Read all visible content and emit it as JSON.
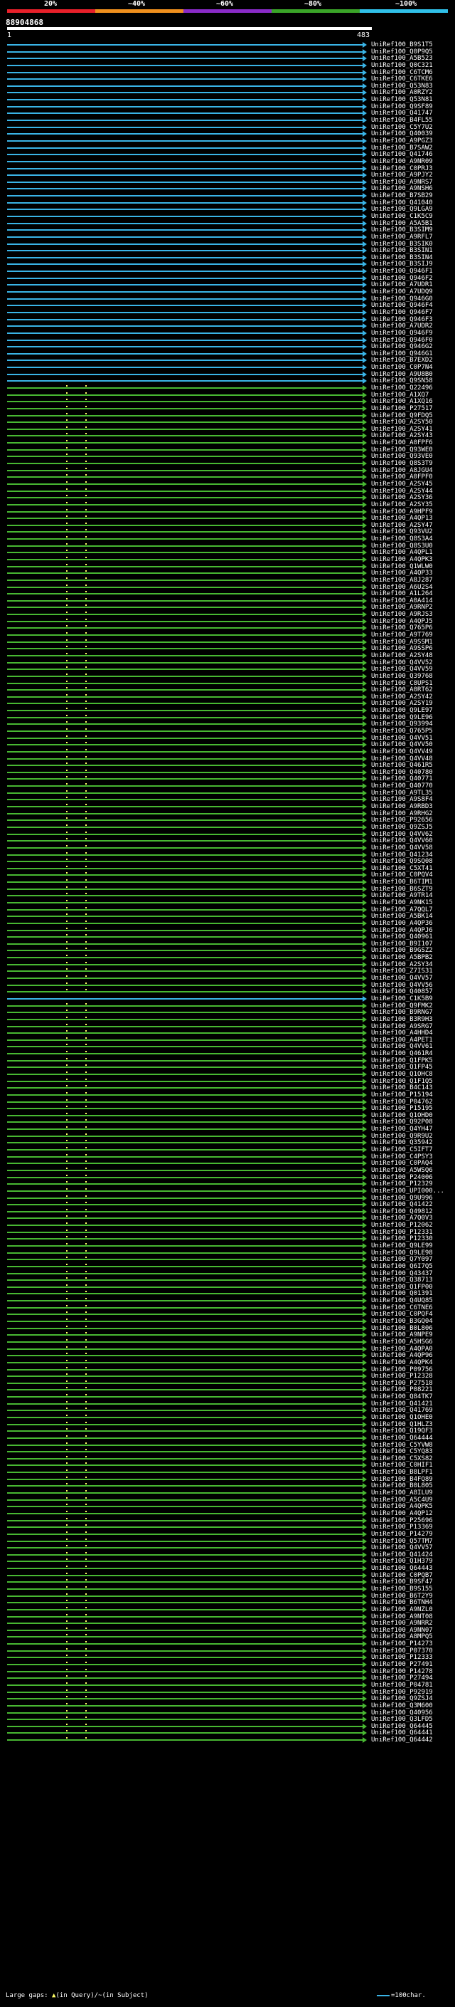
{
  "scale_labels": [
    "20%",
    "~40%",
    "~60%",
    "~80%",
    "~100%"
  ],
  "scale_colors": [
    "#e8202a",
    "#f0901e",
    "#8a2bc8",
    "#3aa428",
    "#30c0e8"
  ],
  "query_id": "88904868",
  "ruler": {
    "start": "1",
    "end": "483"
  },
  "colors": {
    "cyan": "#3ab4e6",
    "green": "#48b832",
    "gap": "#ffff66"
  },
  "hits": [
    {
      "id": "UniRef100_B9S1T5",
      "c": "cyan"
    },
    {
      "id": "UniRef100_Q0P9Q5",
      "c": "cyan"
    },
    {
      "id": "UniRef100_A5B523",
      "c": "cyan"
    },
    {
      "id": "UniRef100_Q0C321",
      "c": "cyan"
    },
    {
      "id": "UniRef100_C6TCM6",
      "c": "cyan"
    },
    {
      "id": "UniRef100_C6TKE6",
      "c": "cyan"
    },
    {
      "id": "UniRef100_Q53N83",
      "c": "cyan"
    },
    {
      "id": "UniRef100_A0RZY2",
      "c": "cyan"
    },
    {
      "id": "UniRef100_Q53N81",
      "c": "cyan"
    },
    {
      "id": "UniRef100_Q9SF89",
      "c": "cyan"
    },
    {
      "id": "UniRef100_Q41747",
      "c": "cyan"
    },
    {
      "id": "UniRef100_B4FL55",
      "c": "cyan"
    },
    {
      "id": "UniRef100_C5Y7U2",
      "c": "cyan"
    },
    {
      "id": "UniRef100_Q40039",
      "c": "cyan"
    },
    {
      "id": "UniRef100_A9PGZ3",
      "c": "cyan"
    },
    {
      "id": "UniRef100_B7SAW2",
      "c": "cyan"
    },
    {
      "id": "UniRef100_Q41746",
      "c": "cyan"
    },
    {
      "id": "UniRef100_A9NR09",
      "c": "cyan"
    },
    {
      "id": "UniRef100_C0PRJ3",
      "c": "cyan"
    },
    {
      "id": "UniRef100_A9PJY2",
      "c": "cyan"
    },
    {
      "id": "UniRef100_A9NRS7",
      "c": "cyan"
    },
    {
      "id": "UniRef100_A9NSH6",
      "c": "cyan"
    },
    {
      "id": "UniRef100_B7SB29",
      "c": "cyan"
    },
    {
      "id": "UniRef100_Q41040",
      "c": "cyan"
    },
    {
      "id": "UniRef100_Q9LGA9",
      "c": "cyan"
    },
    {
      "id": "UniRef100_C1K5C9",
      "c": "cyan"
    },
    {
      "id": "UniRef100_A5A5B1",
      "c": "cyan"
    },
    {
      "id": "UniRef100_B3SIM9",
      "c": "cyan"
    },
    {
      "id": "UniRef100_A9RFL7",
      "c": "cyan"
    },
    {
      "id": "UniRef100_B3SIK0",
      "c": "cyan"
    },
    {
      "id": "UniRef100_B3SIN1",
      "c": "cyan"
    },
    {
      "id": "UniRef100_B3SIN4",
      "c": "cyan"
    },
    {
      "id": "UniRef100_B3SIJ9",
      "c": "cyan"
    },
    {
      "id": "UniRef100_Q946F1",
      "c": "cyan"
    },
    {
      "id": "UniRef100_Q946F2",
      "c": "cyan"
    },
    {
      "id": "UniRef100_A7UDR1",
      "c": "cyan"
    },
    {
      "id": "UniRef100_A7UDQ9",
      "c": "cyan"
    },
    {
      "id": "UniRef100_Q946G0",
      "c": "cyan"
    },
    {
      "id": "UniRef100_Q946F4",
      "c": "cyan"
    },
    {
      "id": "UniRef100_Q946F7",
      "c": "cyan"
    },
    {
      "id": "UniRef100_Q946F3",
      "c": "cyan"
    },
    {
      "id": "UniRef100_A7UDR2",
      "c": "cyan"
    },
    {
      "id": "UniRef100_Q946F9",
      "c": "cyan"
    },
    {
      "id": "UniRef100_Q946F0",
      "c": "cyan"
    },
    {
      "id": "UniRef100_Q946G2",
      "c": "cyan"
    },
    {
      "id": "UniRef100_Q946G1",
      "c": "cyan"
    },
    {
      "id": "UniRef100_B7EXD2",
      "c": "cyan"
    },
    {
      "id": "UniRef100_C0P7N4",
      "c": "cyan"
    },
    {
      "id": "UniRef100_A9U8B0",
      "c": "cyan"
    },
    {
      "id": "UniRef100_Q9SN58",
      "c": "cyan"
    },
    {
      "id": "UniRef100_Q22496",
      "c": "green"
    },
    {
      "id": "UniRef100_A1XQ7",
      "c": "green"
    },
    {
      "id": "UniRef100_A1XQ16",
      "c": "green"
    },
    {
      "id": "UniRef100_P27517",
      "c": "green"
    },
    {
      "id": "UniRef100_Q9FDQ5",
      "c": "green"
    },
    {
      "id": "UniRef100_A2SY50",
      "c": "green"
    },
    {
      "id": "UniRef100_A2SY41",
      "c": "green"
    },
    {
      "id": "UniRef100_A2SY43",
      "c": "green"
    },
    {
      "id": "UniRef100_A0FPF6",
      "c": "green"
    },
    {
      "id": "UniRef100_Q93WE0",
      "c": "green"
    },
    {
      "id": "UniRef100_Q93VE0",
      "c": "green"
    },
    {
      "id": "UniRef100_Q8S3T9",
      "c": "green"
    },
    {
      "id": "UniRef100_A8JGU4",
      "c": "green"
    },
    {
      "id": "UniRef100_A0FPF0",
      "c": "green"
    },
    {
      "id": "UniRef100_A2SY45",
      "c": "green"
    },
    {
      "id": "UniRef100_A2SY44",
      "c": "green"
    },
    {
      "id": "UniRef100_A2SY36",
      "c": "green"
    },
    {
      "id": "UniRef100_A2SY35",
      "c": "green"
    },
    {
      "id": "UniRef100_A9HPF9",
      "c": "green"
    },
    {
      "id": "UniRef100_A4QP13",
      "c": "green"
    },
    {
      "id": "UniRef100_A2SY47",
      "c": "green"
    },
    {
      "id": "UniRef100_Q93VU2",
      "c": "green"
    },
    {
      "id": "UniRef100_Q8S3A4",
      "c": "green"
    },
    {
      "id": "UniRef100_Q8S3U0",
      "c": "green"
    },
    {
      "id": "UniRef100_A4QPL1",
      "c": "green"
    },
    {
      "id": "UniRef100_A4QPK3",
      "c": "green"
    },
    {
      "id": "UniRef100_Q1WLW0",
      "c": "green"
    },
    {
      "id": "UniRef100_A4QP33",
      "c": "green"
    },
    {
      "id": "UniRef100_A8J287",
      "c": "green"
    },
    {
      "id": "UniRef100_A6U2S4",
      "c": "green"
    },
    {
      "id": "UniRef100_A1L264",
      "c": "green"
    },
    {
      "id": "UniRef100_A0A414",
      "c": "green"
    },
    {
      "id": "UniRef100_A9RNP2",
      "c": "green"
    },
    {
      "id": "UniRef100_A9RJS3",
      "c": "green"
    },
    {
      "id": "UniRef100_A4QPJ5",
      "c": "green"
    },
    {
      "id": "UniRef100_Q765P6",
      "c": "green"
    },
    {
      "id": "UniRef100_A9T769",
      "c": "green"
    },
    {
      "id": "UniRef100_A9SSM1",
      "c": "green"
    },
    {
      "id": "UniRef100_A9SSP6",
      "c": "green"
    },
    {
      "id": "UniRef100_A2SY48",
      "c": "green"
    },
    {
      "id": "UniRef100_Q4VV52",
      "c": "green"
    },
    {
      "id": "UniRef100_Q4VV59",
      "c": "green"
    },
    {
      "id": "UniRef100_Q39768",
      "c": "green"
    },
    {
      "id": "UniRef100_C8UPS1",
      "c": "green"
    },
    {
      "id": "UniRef100_A0RT62",
      "c": "green"
    },
    {
      "id": "UniRef100_A2SY42",
      "c": "green"
    },
    {
      "id": "UniRef100_A2SY19",
      "c": "green"
    },
    {
      "id": "UniRef100_Q9LE97",
      "c": "green"
    },
    {
      "id": "UniRef100_Q9LE96",
      "c": "green"
    },
    {
      "id": "UniRef100_Q93994",
      "c": "green"
    },
    {
      "id": "UniRef100_Q765P5",
      "c": "green"
    },
    {
      "id": "UniRef100_Q4VV51",
      "c": "green"
    },
    {
      "id": "UniRef100_Q4VV50",
      "c": "green"
    },
    {
      "id": "UniRef100_Q4VV49",
      "c": "green"
    },
    {
      "id": "UniRef100_Q4VV48",
      "c": "green"
    },
    {
      "id": "UniRef100_Q461R5",
      "c": "green"
    },
    {
      "id": "UniRef100_Q40780",
      "c": "green"
    },
    {
      "id": "UniRef100_Q40771",
      "c": "green"
    },
    {
      "id": "UniRef100_Q40770",
      "c": "green"
    },
    {
      "id": "UniRef100_A9TL35",
      "c": "green"
    },
    {
      "id": "UniRef100_A9S8F4",
      "c": "green"
    },
    {
      "id": "UniRef100_A9RBD3",
      "c": "green"
    },
    {
      "id": "UniRef100_A9RHG2",
      "c": "green"
    },
    {
      "id": "UniRef100_P92656",
      "c": "green"
    },
    {
      "id": "UniRef100_Q9ZSJ5",
      "c": "green"
    },
    {
      "id": "UniRef100_Q4VV62",
      "c": "green"
    },
    {
      "id": "UniRef100_Q4VV60",
      "c": "green"
    },
    {
      "id": "UniRef100_Q4VV58",
      "c": "green"
    },
    {
      "id": "UniRef100_Q41234",
      "c": "green"
    },
    {
      "id": "UniRef100_Q9SQ08",
      "c": "green"
    },
    {
      "id": "UniRef100_C5XT41",
      "c": "green"
    },
    {
      "id": "UniRef100_C0PQV4",
      "c": "green"
    },
    {
      "id": "UniRef100_B6TIM1",
      "c": "green"
    },
    {
      "id": "UniRef100_B6SZT9",
      "c": "green"
    },
    {
      "id": "UniRef100_A9TR14",
      "c": "green"
    },
    {
      "id": "UniRef100_A9NK15",
      "c": "green"
    },
    {
      "id": "UniRef100_A7QQL7",
      "c": "green"
    },
    {
      "id": "UniRef100_A5BK14",
      "c": "green"
    },
    {
      "id": "UniRef100_A4QP36",
      "c": "green"
    },
    {
      "id": "UniRef100_A4QPJ6",
      "c": "green"
    },
    {
      "id": "UniRef100_Q40961",
      "c": "green"
    },
    {
      "id": "UniRef100_B9I107",
      "c": "green"
    },
    {
      "id": "UniRef100_B9GSZ2",
      "c": "green"
    },
    {
      "id": "UniRef100_A5BPB2",
      "c": "green"
    },
    {
      "id": "UniRef100_A2SY34",
      "c": "green"
    },
    {
      "id": "UniRef100_Z7IS31",
      "c": "green"
    },
    {
      "id": "UniRef100_Q4VV57",
      "c": "green"
    },
    {
      "id": "UniRef100_Q4VV56",
      "c": "green"
    },
    {
      "id": "UniRef100_Q40857",
      "c": "green"
    },
    {
      "id": "UniRef100_C1K5B9",
      "c": "cyan"
    },
    {
      "id": "UniRef100_Q9FMK2",
      "c": "green"
    },
    {
      "id": "UniRef100_B9RNG7",
      "c": "green"
    },
    {
      "id": "UniRef100_B3R9H3",
      "c": "green"
    },
    {
      "id": "UniRef100_A9SRG7",
      "c": "green"
    },
    {
      "id": "UniRef100_A4HHD4",
      "c": "green"
    },
    {
      "id": "UniRef100_A4PET1",
      "c": "green"
    },
    {
      "id": "UniRef100_Q4VV61",
      "c": "green"
    },
    {
      "id": "UniRef100_Q461R4",
      "c": "green"
    },
    {
      "id": "UniRef100_Q1FPK5",
      "c": "green"
    },
    {
      "id": "UniRef100_Q1FP45",
      "c": "green"
    },
    {
      "id": "UniRef100_Q1OHC8",
      "c": "green"
    },
    {
      "id": "UniRef100_Q1F1Q5",
      "c": "green"
    },
    {
      "id": "UniRef100_B4C143",
      "c": "green"
    },
    {
      "id": "UniRef100_P15194",
      "c": "green"
    },
    {
      "id": "UniRef100_P04762",
      "c": "green"
    },
    {
      "id": "UniRef100_P15195",
      "c": "green"
    },
    {
      "id": "UniRef100_Q1OHD0",
      "c": "green"
    },
    {
      "id": "UniRef100_Q92P08",
      "c": "green"
    },
    {
      "id": "UniRef100_Q4YH47",
      "c": "green"
    },
    {
      "id": "UniRef100_Q9R9U2",
      "c": "green"
    },
    {
      "id": "UniRef100_Q35942",
      "c": "green"
    },
    {
      "id": "UniRef100_C5IFT7",
      "c": "green"
    },
    {
      "id": "UniRef100_C4PSY3",
      "c": "green"
    },
    {
      "id": "UniRef100_C0PAQ4",
      "c": "green"
    },
    {
      "id": "UniRef100_A5WSQ6",
      "c": "green"
    },
    {
      "id": "UniRef100_P24006",
      "c": "green"
    },
    {
      "id": "UniRef100_P12329",
      "c": "green"
    },
    {
      "id": "UniRef100_UPI000...",
      "c": "green"
    },
    {
      "id": "UniRef100_Q9U996",
      "c": "green"
    },
    {
      "id": "UniRef100_Q41422",
      "c": "green"
    },
    {
      "id": "UniRef100_Q49812",
      "c": "green"
    },
    {
      "id": "UniRef100_A7Q0V3",
      "c": "green"
    },
    {
      "id": "UniRef100_P12062",
      "c": "green"
    },
    {
      "id": "UniRef100_P12331",
      "c": "green"
    },
    {
      "id": "UniRef100_P12330",
      "c": "green"
    },
    {
      "id": "UniRef100_Q9LE99",
      "c": "green"
    },
    {
      "id": "UniRef100_Q9LE98",
      "c": "green"
    },
    {
      "id": "UniRef100_Q7Y097",
      "c": "green"
    },
    {
      "id": "UniRef100_Q6I7Q5",
      "c": "green"
    },
    {
      "id": "UniRef100_Q43437",
      "c": "green"
    },
    {
      "id": "UniRef100_Q38713",
      "c": "green"
    },
    {
      "id": "UniRef100_Q1FP00",
      "c": "green"
    },
    {
      "id": "UniRef100_Q01391",
      "c": "green"
    },
    {
      "id": "UniRef100_Q4UQ85",
      "c": "green"
    },
    {
      "id": "UniRef100_C6TNE6",
      "c": "green"
    },
    {
      "id": "UniRef100_C0PQF4",
      "c": "green"
    },
    {
      "id": "UniRef100_B3GQ04",
      "c": "green"
    },
    {
      "id": "UniRef100_B0L806",
      "c": "green"
    },
    {
      "id": "UniRef100_A9NPE9",
      "c": "green"
    },
    {
      "id": "UniRef100_A5HSG6",
      "c": "green"
    },
    {
      "id": "UniRef100_A4QPA0",
      "c": "green"
    },
    {
      "id": "UniRef100_A4QP96",
      "c": "green"
    },
    {
      "id": "UniRef100_A4QPK4",
      "c": "green"
    },
    {
      "id": "UniRef100_P09756",
      "c": "green"
    },
    {
      "id": "UniRef100_P12328",
      "c": "green"
    },
    {
      "id": "UniRef100_P27518",
      "c": "green"
    },
    {
      "id": "UniRef100_P08221",
      "c": "green"
    },
    {
      "id": "UniRef100_Q84TK7",
      "c": "green"
    },
    {
      "id": "UniRef100_Q41421",
      "c": "green"
    },
    {
      "id": "UniRef100_Q41769",
      "c": "green"
    },
    {
      "id": "UniRef100_Q1OHE0",
      "c": "green"
    },
    {
      "id": "UniRef100_Q1HLZ3",
      "c": "green"
    },
    {
      "id": "UniRef100_Q19QF3",
      "c": "green"
    },
    {
      "id": "UniRef100_Q64444",
      "c": "green"
    },
    {
      "id": "UniRef100_C5YVW8",
      "c": "green"
    },
    {
      "id": "UniRef100_C5YQ83",
      "c": "green"
    },
    {
      "id": "UniRef100_C5XS82",
      "c": "green"
    },
    {
      "id": "UniRef100_C0HIF1",
      "c": "green"
    },
    {
      "id": "UniRef100_B8LPF1",
      "c": "green"
    },
    {
      "id": "UniRef100_B4FQ89",
      "c": "green"
    },
    {
      "id": "UniRef100_B0L805",
      "c": "green"
    },
    {
      "id": "UniRef100_A8ILU9",
      "c": "green"
    },
    {
      "id": "UniRef100_A5C4U9",
      "c": "green"
    },
    {
      "id": "UniRef100_A4QPK5",
      "c": "green"
    },
    {
      "id": "UniRef100_A4QP12",
      "c": "green"
    },
    {
      "id": "UniRef100_P25696",
      "c": "green"
    },
    {
      "id": "UniRef100_P13369",
      "c": "green"
    },
    {
      "id": "UniRef100_P14279",
      "c": "green"
    },
    {
      "id": "UniRef100_Q57TM7",
      "c": "green"
    },
    {
      "id": "UniRef100_Q4VV57",
      "c": "green"
    },
    {
      "id": "UniRef100_Q41424",
      "c": "green"
    },
    {
      "id": "UniRef100_Q1H379",
      "c": "green"
    },
    {
      "id": "UniRef100_Q64443",
      "c": "green"
    },
    {
      "id": "UniRef100_C0PQB7",
      "c": "green"
    },
    {
      "id": "UniRef100_B9SF47",
      "c": "green"
    },
    {
      "id": "UniRef100_B9S155",
      "c": "green"
    },
    {
      "id": "UniRef100_B6T2Y9",
      "c": "green"
    },
    {
      "id": "UniRef100_B6TNH4",
      "c": "green"
    },
    {
      "id": "UniRef100_A9NZL0",
      "c": "green"
    },
    {
      "id": "UniRef100_A9NT08",
      "c": "green"
    },
    {
      "id": "UniRef100_A9NRR2",
      "c": "green"
    },
    {
      "id": "UniRef100_A9NN07",
      "c": "green"
    },
    {
      "id": "UniRef100_A8MPQ5",
      "c": "green"
    },
    {
      "id": "UniRef100_P14273",
      "c": "green"
    },
    {
      "id": "UniRef100_P07370",
      "c": "green"
    },
    {
      "id": "UniRef100_P12333",
      "c": "green"
    },
    {
      "id": "UniRef100_P27491",
      "c": "green"
    },
    {
      "id": "UniRef100_P14278",
      "c": "green"
    },
    {
      "id": "UniRef100_P27494",
      "c": "green"
    },
    {
      "id": "UniRef100_P04781",
      "c": "green"
    },
    {
      "id": "UniRef100_P92919",
      "c": "green"
    },
    {
      "id": "UniRef100_Q9ZSJ4",
      "c": "green"
    },
    {
      "id": "UniRef100_Q3M600",
      "c": "green"
    },
    {
      "id": "UniRef100_Q40956",
      "c": "green"
    },
    {
      "id": "UniRef100_Q3LFD5",
      "c": "green"
    },
    {
      "id": "UniRef100_Q64445",
      "c": "green"
    },
    {
      "id": "UniRef100_Q64441",
      "c": "green"
    },
    {
      "id": "UniRef100_Q64442",
      "c": "green"
    }
  ],
  "legend": {
    "prefix": "Large gaps: ",
    "query_mark": "▲",
    "query_text": "(in Query)/",
    "subject_mark": "~",
    "subject_text": "(in Subject)",
    "scale_text": "=100char."
  }
}
